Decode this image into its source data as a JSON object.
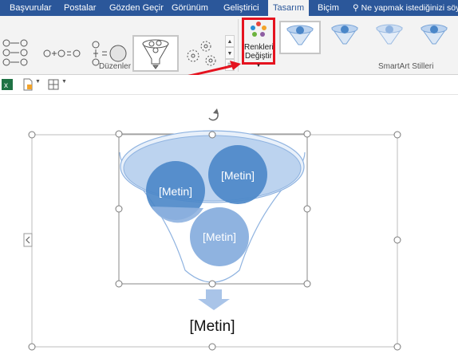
{
  "tabs": [
    {
      "label": "Başvurular"
    },
    {
      "label": "Postalar"
    },
    {
      "label": "Gözden Geçir"
    },
    {
      "label": "Görünüm"
    },
    {
      "label": "Geliştirici"
    },
    {
      "label": "Tasarım"
    },
    {
      "label": "Biçim"
    }
  ],
  "tell_me": "Ne yapmak istediğinizi söy",
  "ribbon": {
    "group_layouts": "Düzenler",
    "group_styles": "SmartArt Stilleri",
    "change_colors_line1": "Renkleri",
    "change_colors_line2": "Değiştir"
  },
  "diagram": {
    "circle1": "[Metin]",
    "circle2": "[Metin]",
    "circle3": "[Metin]",
    "bottom": "[Metin]"
  },
  "colors": {
    "tab_bar": "#2b579a",
    "highlight": "#e5131f",
    "shape_dark": "#4a86c8",
    "shape_light": "#8fb3e0"
  },
  "icons": [
    "excel-icon",
    "new-document-icon",
    "layout-icon",
    "scroll-up-icon",
    "scroll-down-icon",
    "more-icon",
    "rotate-icon",
    "expand-pane-icon",
    "funnel-arrow-icon"
  ]
}
